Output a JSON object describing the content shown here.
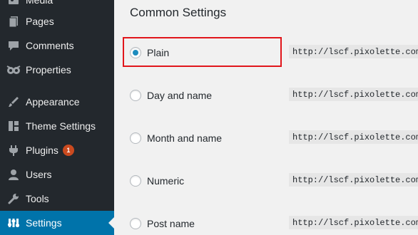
{
  "sidebar": {
    "items": [
      {
        "label": "Media",
        "icon": "media-icon"
      },
      {
        "label": "Pages",
        "icon": "pages-icon"
      },
      {
        "label": "Comments",
        "icon": "comments-icon"
      },
      {
        "label": "Properties",
        "icon": "properties-icon"
      },
      {
        "label": "Appearance",
        "icon": "appearance-icon"
      },
      {
        "label": "Theme Settings",
        "icon": "theme-settings-icon"
      },
      {
        "label": "Plugins",
        "icon": "plugins-icon",
        "badge": "1"
      },
      {
        "label": "Users",
        "icon": "users-icon"
      },
      {
        "label": "Tools",
        "icon": "tools-icon"
      },
      {
        "label": "Settings",
        "icon": "settings-icon",
        "active": true
      }
    ]
  },
  "main": {
    "section_title": "Common Settings",
    "options": [
      {
        "label": "Plain",
        "selected": true,
        "url": "http://lscf.pixolette.com"
      },
      {
        "label": "Day and name",
        "selected": false,
        "url": "http://lscf.pixolette.com"
      },
      {
        "label": "Month and name",
        "selected": false,
        "url": "http://lscf.pixolette.com"
      },
      {
        "label": "Numeric",
        "selected": false,
        "url": "http://lscf.pixolette.com"
      },
      {
        "label": "Post name",
        "selected": false,
        "url": "http://lscf.pixolette.com"
      }
    ]
  },
  "colors": {
    "sidebar_bg": "#23282d",
    "active_bg": "#0073aa",
    "badge_bg": "#ca4a1f",
    "highlight_border": "#e1161b",
    "radio_checked": "#1e8cbe"
  }
}
